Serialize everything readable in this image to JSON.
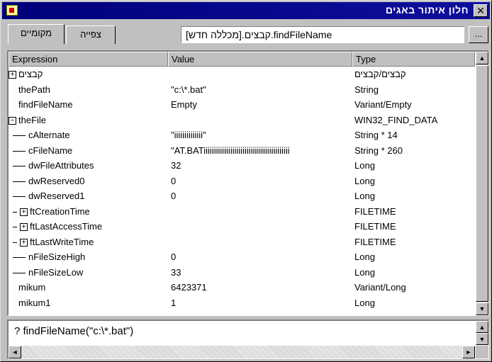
{
  "window": {
    "title": "חלון איתור באגים",
    "close_label": "✕"
  },
  "tabs": {
    "locals_label": "מקומיים",
    "watch_label": "צפייה"
  },
  "context": {
    "value": "[מכללה חדש].קבצים.findFileName",
    "ellipsis_label": "..."
  },
  "grid": {
    "headers": {
      "expression": "Expression",
      "value": "Value",
      "type": "Type"
    },
    "rows": [
      {
        "expression": "קבצים",
        "value": "",
        "type": "קבצים/קבצים",
        "kind": "expand-plus",
        "indent": 0
      },
      {
        "expression": "thePath",
        "value": "\"c:\\*.bat\"",
        "type": "String",
        "kind": "plain",
        "indent": 1
      },
      {
        "expression": "findFileName",
        "value": "Empty",
        "type": "Variant/Empty",
        "kind": "plain",
        "indent": 1
      },
      {
        "expression": "theFile",
        "value": "",
        "type": "WIN32_FIND_DATA",
        "kind": "expand-minus",
        "indent": 0
      },
      {
        "expression": "cAlternate",
        "value": "\"iiiiiiiiiiiiii\"",
        "type": "String * 14",
        "kind": "child",
        "indent": 2
      },
      {
        "expression": "cFileName",
        "value": "\"AT.BATiiiiiiiiiiiiiiiiiiiiiiiiiiiiiiiiiiiiiiiiii",
        "type": "String * 260",
        "kind": "child",
        "indent": 2
      },
      {
        "expression": "dwFileAttributes",
        "value": "32",
        "type": "Long",
        "kind": "child",
        "indent": 2
      },
      {
        "expression": "dwReserved0",
        "value": "0",
        "type": "Long",
        "kind": "child",
        "indent": 2
      },
      {
        "expression": "dwReserved1",
        "value": "0",
        "type": "Long",
        "kind": "child",
        "indent": 2
      },
      {
        "expression": "ftCreationTime",
        "value": "",
        "type": "FILETIME",
        "kind": "child-plus",
        "indent": 2
      },
      {
        "expression": "ftLastAccessTime",
        "value": "",
        "type": "FILETIME",
        "kind": "child-plus",
        "indent": 2
      },
      {
        "expression": "ftLastWriteTime",
        "value": "",
        "type": "FILETIME",
        "kind": "child-plus",
        "indent": 2
      },
      {
        "expression": "nFileSizeHigh",
        "value": "0",
        "type": "Long",
        "kind": "child",
        "indent": 2
      },
      {
        "expression": "nFileSizeLow",
        "value": "33",
        "type": "Long",
        "kind": "child-last",
        "indent": 2
      },
      {
        "expression": "mikum",
        "value": "6423371",
        "type": "Variant/Long",
        "kind": "plain",
        "indent": 1
      },
      {
        "expression": "mikum1",
        "value": "1",
        "type": "Long",
        "kind": "plain",
        "indent": 1
      }
    ]
  },
  "immediate": {
    "text": "? findFileName(\"c:\\*.bat\")"
  },
  "icons": {
    "expand": "⊞",
    "collapse": "⊟",
    "up": "▲",
    "down": "▼",
    "left": "◄",
    "right": "►"
  }
}
